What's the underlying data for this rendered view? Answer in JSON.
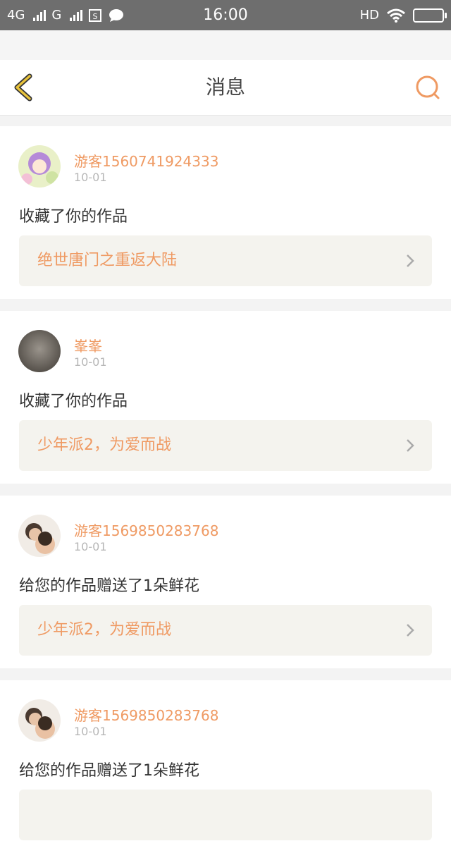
{
  "status_bar": {
    "left_network_1": "4G",
    "left_network_2": "G",
    "time": "16:00",
    "hd_label": "HD",
    "icons": [
      "signal-icon",
      "sim-icon",
      "message-bubble-icon",
      "wifi-icon",
      "battery-icon"
    ]
  },
  "header": {
    "title": "消息",
    "back_icon": "chevron-left-icon",
    "search_icon": "search-icon",
    "accent_color": "#ef9a63"
  },
  "messages": [
    {
      "user": "游客1560741924333",
      "date": "10-01",
      "action": "收藏了你的作品",
      "work_title": "绝世唐门之重返大陆",
      "avatar_icon": "avatar-anime-girl"
    },
    {
      "user": "峯峯",
      "date": "10-01",
      "action": "收藏了你的作品",
      "work_title": "少年派2，为爱而战",
      "avatar_icon": "avatar-gray"
    },
    {
      "user": "游客1569850283768",
      "date": "10-01",
      "action": "给您的作品赠送了1朵鲜花",
      "work_title": "少年派2，为爱而战",
      "avatar_icon": "avatar-photo"
    },
    {
      "user": "游客1569850283768",
      "date": "10-01",
      "action": "给您的作品赠送了1朵鲜花",
      "work_title": "",
      "avatar_icon": "avatar-photo"
    }
  ]
}
